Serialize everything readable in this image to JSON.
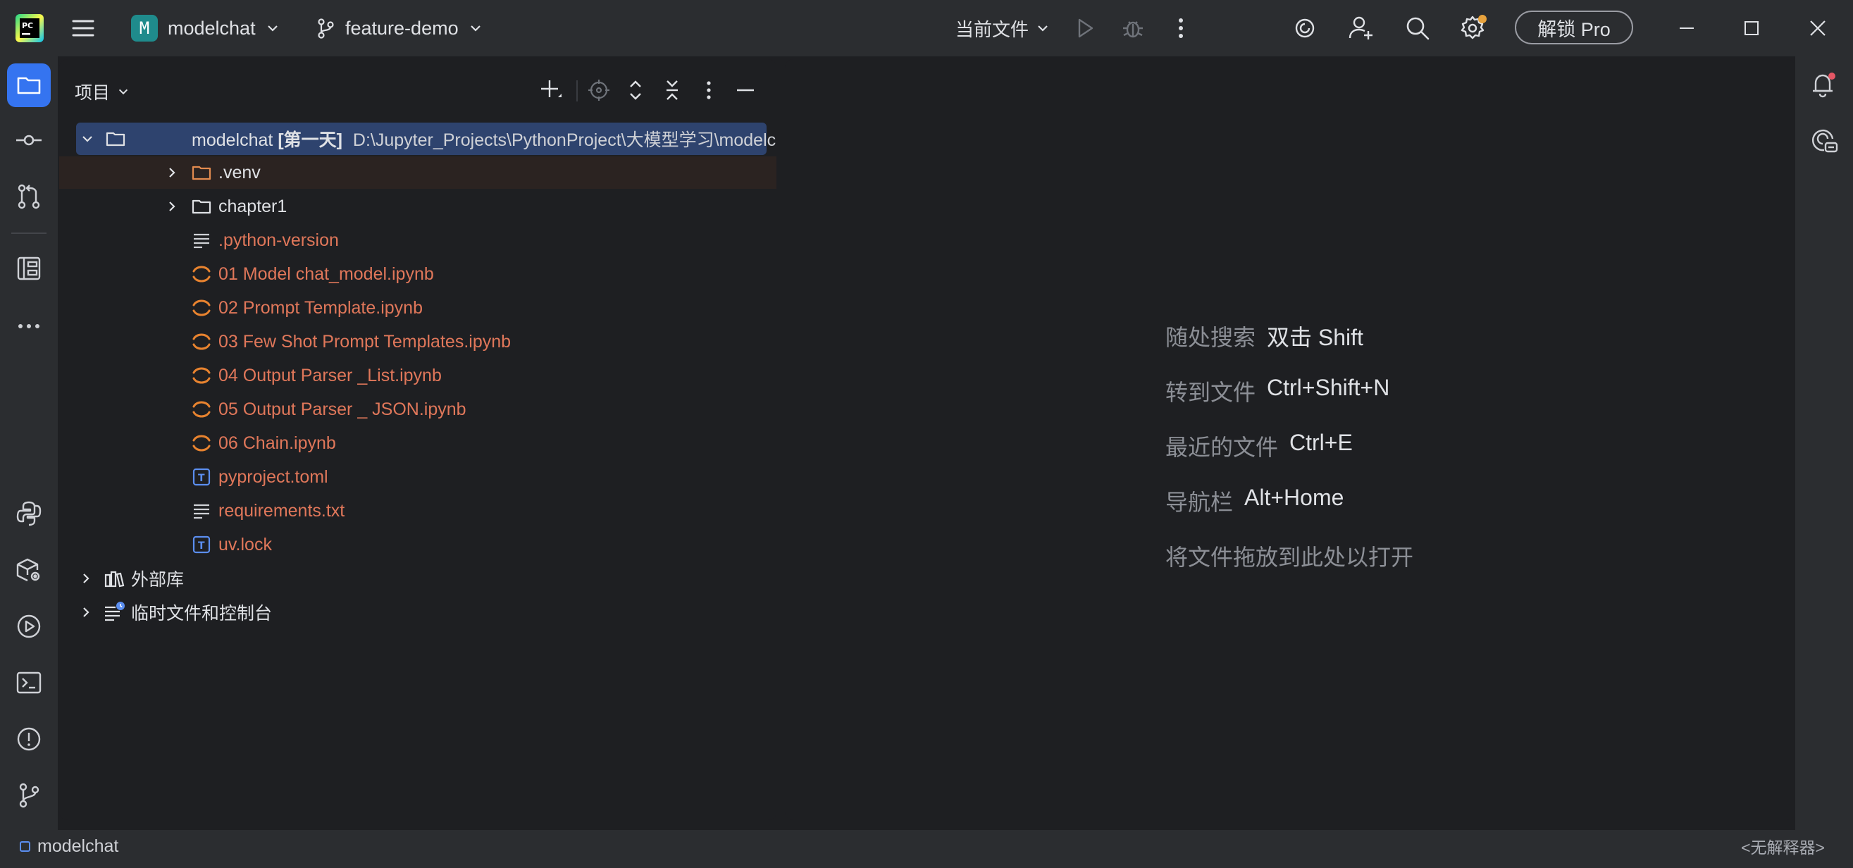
{
  "titlebar": {
    "project_badge": "M",
    "project_name": "modelchat",
    "branch_name": "feature-demo",
    "run_config": "当前文件",
    "pro_button": "解锁 Pro"
  },
  "project_panel": {
    "title": "项目",
    "tree": [
      {
        "id": "root",
        "name": "modelchat",
        "tag": "[第一天]",
        "path": "D:\\Jupyter_Projects\\PythonProject\\大模型学习\\modelchat"
      },
      {
        "id": "venv",
        "name": ".venv"
      },
      {
        "id": "chapter1",
        "name": "chapter1"
      },
      {
        "id": "python-version",
        "name": ".python-version"
      },
      {
        "id": "nb01",
        "name": "01 Model chat_model.ipynb"
      },
      {
        "id": "nb02",
        "name": "02 Prompt Template.ipynb"
      },
      {
        "id": "nb03",
        "name": "03 Few Shot Prompt Templates.ipynb"
      },
      {
        "id": "nb04",
        "name": "04 Output Parser _List.ipynb"
      },
      {
        "id": "nb05",
        "name": "05 Output Parser _ JSON.ipynb"
      },
      {
        "id": "nb06",
        "name": "06 Chain.ipynb"
      },
      {
        "id": "pyproject",
        "name": "pyproject.toml"
      },
      {
        "id": "requirements",
        "name": "requirements.txt"
      },
      {
        "id": "uvlock",
        "name": "uv.lock"
      },
      {
        "id": "external",
        "name": "外部库"
      },
      {
        "id": "scratches",
        "name": "临时文件和控制台"
      }
    ]
  },
  "editor_hints": [
    {
      "label": "随处搜索",
      "shortcut": "双击 Shift"
    },
    {
      "label": "转到文件",
      "shortcut": "Ctrl+Shift+N"
    },
    {
      "label": "最近的文件",
      "shortcut": "Ctrl+E"
    },
    {
      "label": "导航栏",
      "shortcut": "Alt+Home"
    },
    {
      "label": "将文件拖放到此处以打开",
      "shortcut": ""
    }
  ],
  "statusbar": {
    "project": "modelchat",
    "interpreter": "<无解释器>"
  },
  "colors": {
    "accent": "#3574f0",
    "selection": "#2e436e",
    "modified_file": "#e0775a",
    "notebook_icon": "#e8832f"
  }
}
